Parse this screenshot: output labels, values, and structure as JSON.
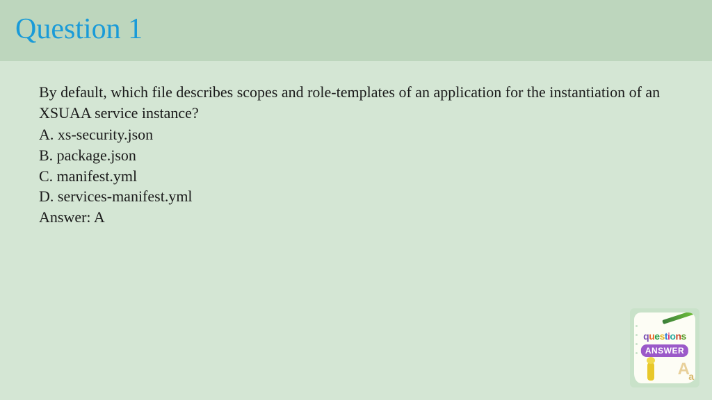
{
  "header": {
    "title": "Question 1"
  },
  "question": {
    "text": "By default, which file describes scopes and role-templates of an application for the instantiation of an XSUAA service instance?",
    "options": {
      "a": "A. xs-security.json",
      "b": "B. package.json",
      "c": "C. manifest.yml",
      "d": "D. services-manifest.yml"
    },
    "answer": "Answer: A"
  },
  "badge": {
    "questions": "questions",
    "answer": "ANSWER"
  }
}
